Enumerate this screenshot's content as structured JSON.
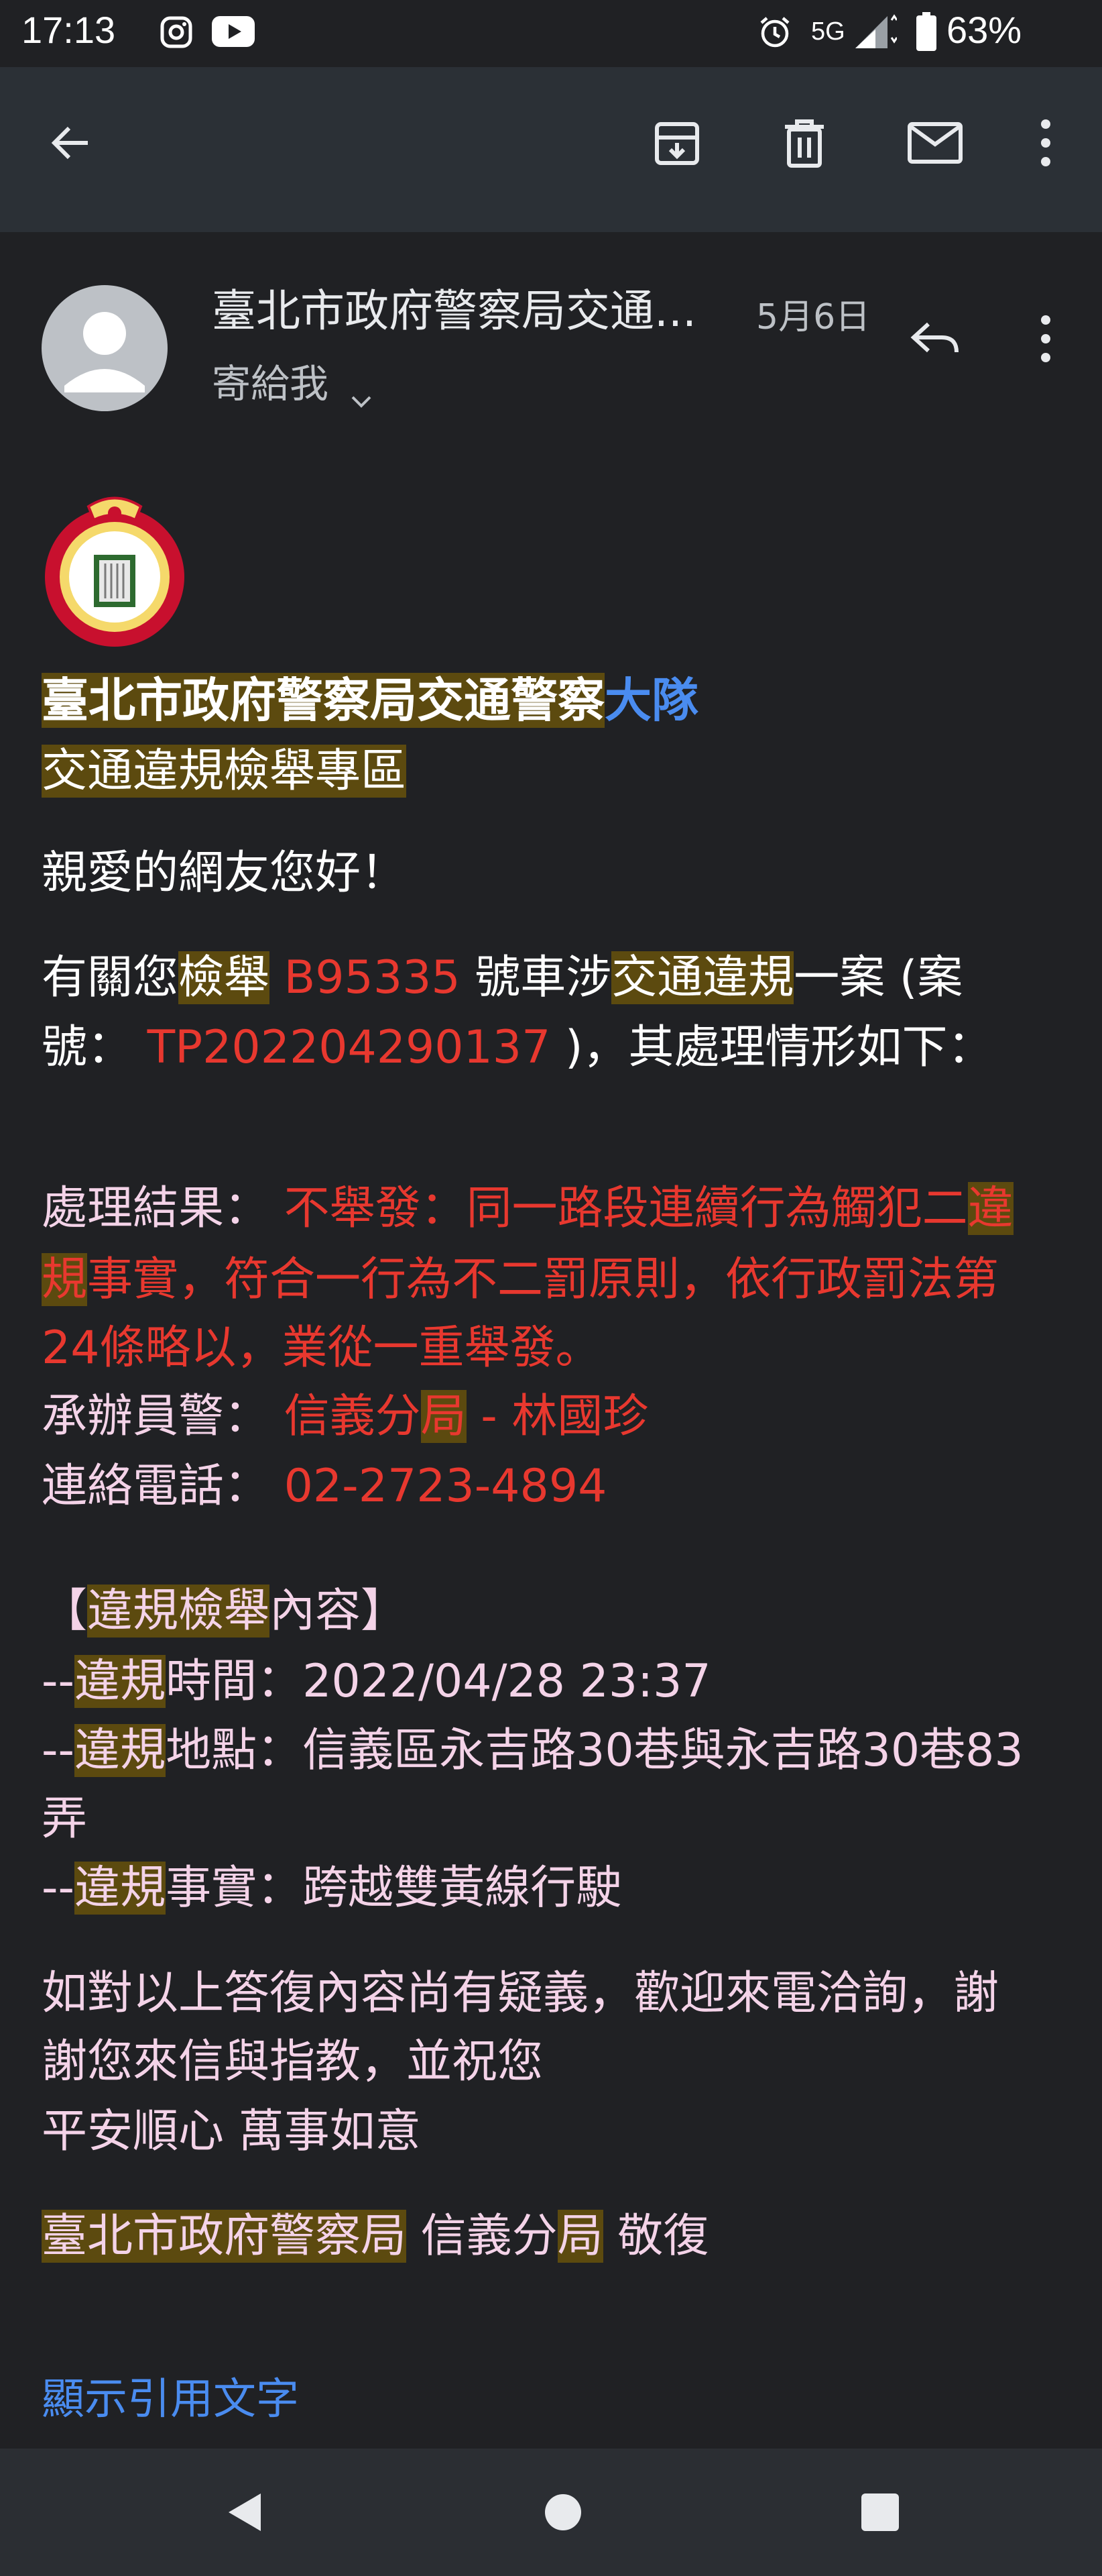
{
  "status": {
    "time": "17:13",
    "network": "5G",
    "battery": "63%"
  },
  "email": {
    "sender": "臺北市政府警察局交通...",
    "date": "5月6日",
    "recipient": "寄給我",
    "title_line1_part1": "臺北市政府警察局交通警察",
    "title_line1_part2": "大隊",
    "title_line2": "交通違規檢舉專區",
    "greeting": "親愛的網友您好！",
    "intro": {
      "p1": "有關您",
      "p2": "檢舉",
      "plate": " B95335",
      "p3": " 號車涉",
      "p4": "交通違規",
      "p5": "一案 (案",
      "p6": "號： ",
      "case_no": "TP202204290137",
      "p7": " )，其處理情形如下："
    },
    "result": {
      "label": "處理結果：",
      "l1": " 不舉發：同一路段連續行為觸犯二",
      "l1hl": "違",
      "l2hl": "規",
      "l2": "事實，符合一行為不二罰原則，依行政罰法第",
      "l3": "24條略以，業從一重舉發。"
    },
    "officer": {
      "label": "承辦員警：",
      "v1": " 信義分",
      "v2": "局",
      "v3": " - 林國珍"
    },
    "phone": {
      "label": "連絡電話：",
      "value": " 02-2723-4894"
    },
    "content": {
      "h1": "【",
      "h2": "違規檢舉",
      "h3": "內容】",
      "d": "--",
      "vr": "違規",
      "time_rest": "時間：2022/04/28 23:37",
      "loc_rest": "地點：信義區永吉路30巷與永吉路30巷83",
      "loc_cont": "弄",
      "fact_rest": "事實：跨越雙黃線行駛"
    },
    "closing": {
      "l1": "如對以上答復內容尚有疑義，歡迎來電洽詢，謝",
      "l2": "謝您來信與指教，並祝您",
      "l3": "平安順心 萬事如意"
    },
    "sign": {
      "s1": "臺北市政府警察局",
      "s2": " 信義分",
      "s3": "局",
      "s4": " 敬復"
    },
    "show_quoted": "顯示引用文字"
  }
}
